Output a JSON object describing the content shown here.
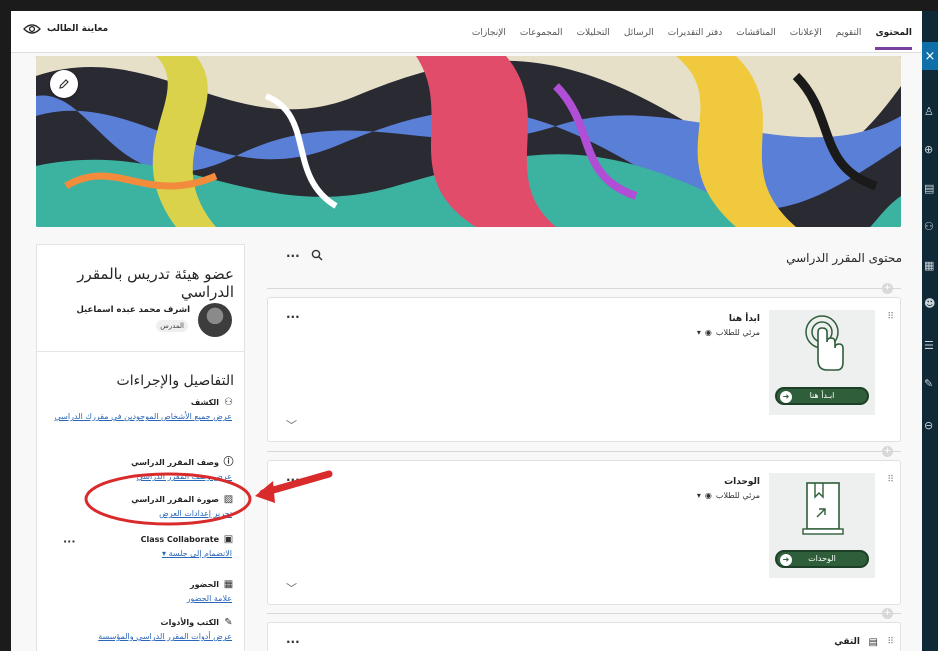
{
  "topbar": {
    "tabs": [
      {
        "label": "المحتوى",
        "active": true
      },
      {
        "label": "التقويم"
      },
      {
        "label": "الإعلانات"
      },
      {
        "label": "المناقشات"
      },
      {
        "label": "دفتر التقديرات"
      },
      {
        "label": "الرسائل"
      },
      {
        "label": "التحليلات"
      },
      {
        "label": "المجموعات"
      },
      {
        "label": "الإنجازات"
      }
    ],
    "student_preview": "معاينة الطالب"
  },
  "close_label": "×",
  "instructor": {
    "title": "عضو هيئة تدريس بالمقرر الدراسي",
    "name": "اشرف محمد عبده اسماعيل",
    "role": "المدرس"
  },
  "details": {
    "title": "التفاصيل والإجراءات",
    "items": [
      {
        "heading": "الكشف",
        "link": "عرض جميع الأشخاص الموجودين في مقررك الدراسي",
        "icon": "roster-icon"
      },
      {
        "heading": "وصف المقرر الدراسي",
        "link": "عرض وصف المقرر الدراسي",
        "icon": "info-icon"
      },
      {
        "heading": "صورة المقرر الدراسي",
        "link": "تحرير إعدادات العرض",
        "icon": "image-icon"
      },
      {
        "heading": "Class Collaborate",
        "link": "الانضمام إلى جلسة",
        "icon": "collaborate-icon"
      },
      {
        "heading": "الحضور",
        "link": "علامة الحضور",
        "icon": "attendance-icon"
      },
      {
        "heading": "الكتب والأدوات",
        "link": "عرض أدوات المقرر الدراسي والمؤسسة",
        "icon": "tools-icon"
      }
    ]
  },
  "content": {
    "heading": "محتوى المقرر الدراسي",
    "cards": [
      {
        "title": "ابدأ هنا",
        "visibility": "مرئي للطلاب",
        "thumb_label": "ابـدأ هنا",
        "thumb_icon": "tap-hand-icon"
      },
      {
        "title": "الوحدات",
        "visibility": "مرئي للطلاب",
        "thumb_label": "الوحدات",
        "thumb_icon": "book-icon"
      },
      {
        "title": "التقي",
        "visibility": "",
        "thumb_label": "",
        "thumb_icon": "document-icon"
      }
    ]
  },
  "colors": {
    "accent": "#7b3fa0",
    "link": "#2b67b8",
    "pill": "#2e5e3a",
    "annotation": "#d92b2b"
  }
}
